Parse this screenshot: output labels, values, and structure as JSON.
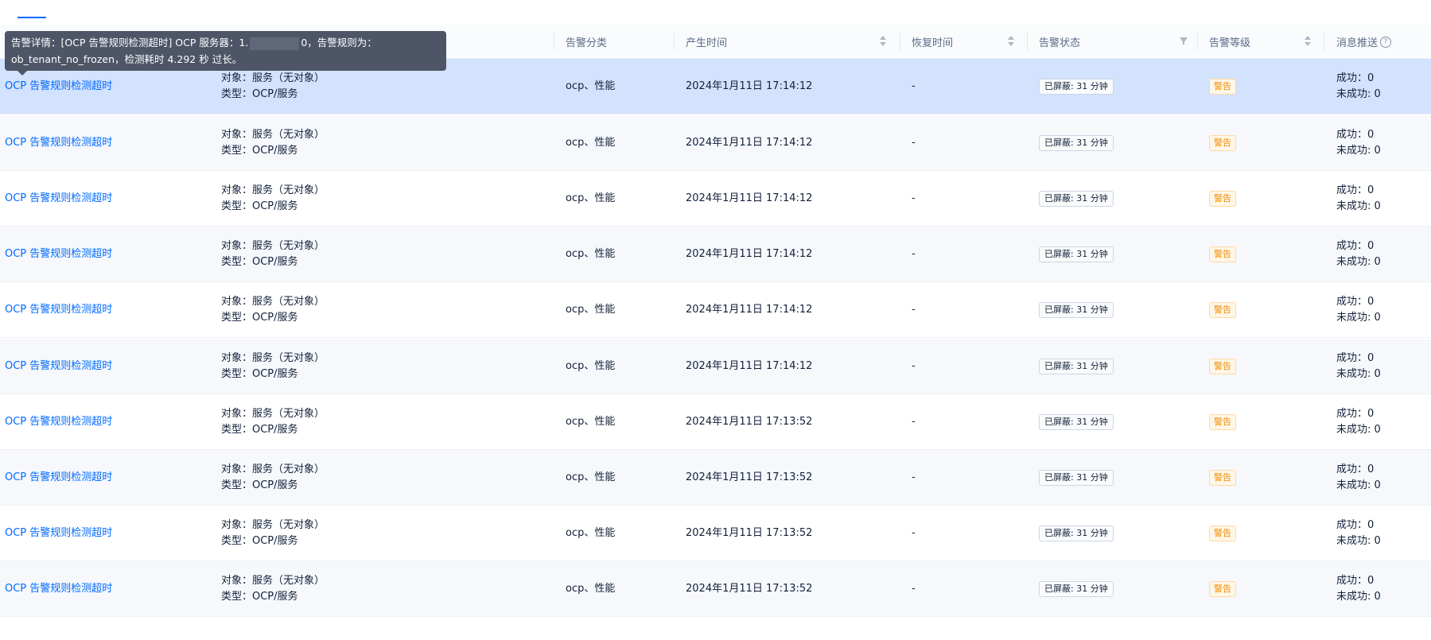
{
  "header": {
    "columns": [
      "告警分类",
      "产生时间",
      "恢复时间",
      "告警状态",
      "告警等级",
      "消息推送"
    ],
    "help_icon": "?"
  },
  "tooltip": {
    "line1_prefix": "告警详情：[OCP 告警规则检测超时] OCP 服务器：1.",
    "line1_suffix": "0，告警规则为：",
    "line2": "ob_tenant_no_frozen，检测耗时 4.292 秒 过长。"
  },
  "rows": [
    {
      "name": "OCP 告警规则检测超时",
      "object": "对象：服务（无对象）",
      "type": "类型：OCP/服务",
      "category": "ocp、性能",
      "time": "2024年1月11日 17:14:12",
      "recover": "-",
      "status": "已屏蔽: 31 分钟",
      "level": "警告",
      "success": "成功：0",
      "fail": "未成功: 0"
    },
    {
      "name": "OCP 告警规则检测超时",
      "object": "对象：服务（无对象）",
      "type": "类型：OCP/服务",
      "category": "ocp、性能",
      "time": "2024年1月11日 17:14:12",
      "recover": "-",
      "status": "已屏蔽: 31 分钟",
      "level": "警告",
      "success": "成功：0",
      "fail": "未成功: 0"
    },
    {
      "name": "OCP 告警规则检测超时",
      "object": "对象：服务（无对象）",
      "type": "类型：OCP/服务",
      "category": "ocp、性能",
      "time": "2024年1月11日 17:14:12",
      "recover": "-",
      "status": "已屏蔽: 31 分钟",
      "level": "警告",
      "success": "成功：0",
      "fail": "未成功: 0"
    },
    {
      "name": "OCP 告警规则检测超时",
      "object": "对象：服务（无对象）",
      "type": "类型：OCP/服务",
      "category": "ocp、性能",
      "time": "2024年1月11日 17:14:12",
      "recover": "-",
      "status": "已屏蔽: 31 分钟",
      "level": "警告",
      "success": "成功：0",
      "fail": "未成功: 0"
    },
    {
      "name": "OCP 告警规则检测超时",
      "object": "对象：服务（无对象）",
      "type": "类型：OCP/服务",
      "category": "ocp、性能",
      "time": "2024年1月11日 17:14:12",
      "recover": "-",
      "status": "已屏蔽: 31 分钟",
      "level": "警告",
      "success": "成功：0",
      "fail": "未成功: 0"
    },
    {
      "name": "OCP 告警规则检测超时",
      "object": "对象：服务（无对象）",
      "type": "类型：OCP/服务",
      "category": "ocp、性能",
      "time": "2024年1月11日 17:14:12",
      "recover": "-",
      "status": "已屏蔽: 31 分钟",
      "level": "警告",
      "success": "成功：0",
      "fail": "未成功: 0"
    },
    {
      "name": "OCP 告警规则检测超时",
      "object": "对象：服务（无对象）",
      "type": "类型：OCP/服务",
      "category": "ocp、性能",
      "time": "2024年1月11日 17:13:52",
      "recover": "-",
      "status": "已屏蔽: 31 分钟",
      "level": "警告",
      "success": "成功：0",
      "fail": "未成功: 0"
    },
    {
      "name": "OCP 告警规则检测超时",
      "object": "对象：服务（无对象）",
      "type": "类型：OCP/服务",
      "category": "ocp、性能",
      "time": "2024年1月11日 17:13:52",
      "recover": "-",
      "status": "已屏蔽: 31 分钟",
      "level": "警告",
      "success": "成功：0",
      "fail": "未成功: 0"
    },
    {
      "name": "OCP 告警规则检测超时",
      "object": "对象：服务（无对象）",
      "type": "类型：OCP/服务",
      "category": "ocp、性能",
      "time": "2024年1月11日 17:13:52",
      "recover": "-",
      "status": "已屏蔽: 31 分钟",
      "level": "警告",
      "success": "成功：0",
      "fail": "未成功: 0"
    },
    {
      "name": "OCP 告警规则检测超时",
      "object": "对象：服务（无对象）",
      "type": "类型：OCP/服务",
      "category": "ocp、性能",
      "time": "2024年1月11日 17:13:52",
      "recover": "-",
      "status": "已屏蔽: 31 分钟",
      "level": "警告",
      "success": "成功：0",
      "fail": "未成功: 0"
    }
  ]
}
